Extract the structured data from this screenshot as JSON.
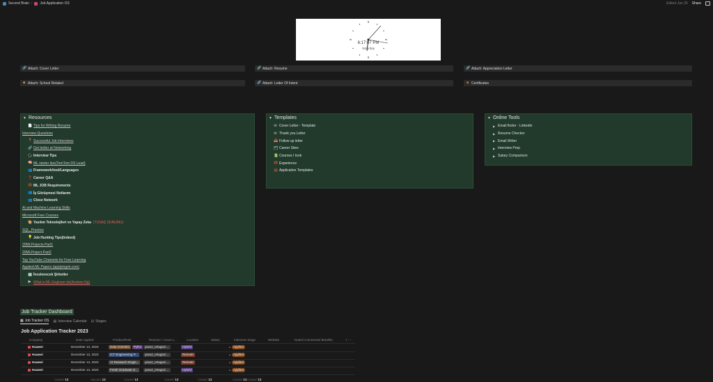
{
  "breadcrumb": {
    "workspace": "Second Brain",
    "page": "Job Application OS"
  },
  "topbar": {
    "edited": "Edited Jan 26",
    "share": "Share"
  },
  "clock": {
    "time": "6:17:07 PM",
    "day": "Saturday"
  },
  "attachments": [
    {
      "label": "Attach: Cover Letter",
      "icon": "link-icon"
    },
    {
      "label": "Attach: Resume",
      "icon": "link-icon"
    },
    {
      "label": "Attach: Appreciation Letter",
      "icon": "link-icon"
    },
    {
      "label": "Attach: School Related",
      "icon": "folder-icon"
    },
    {
      "label": "Attach: Letter Of Intent",
      "icon": "link-icon"
    },
    {
      "label": "Certificates",
      "icon": "certificate-icon"
    }
  ],
  "resources": {
    "title": "Resources",
    "items": [
      {
        "label": "Tips for Writing Resume",
        "style": "link",
        "icon": "📄"
      },
      {
        "label": "Interview Questions",
        "style": "link",
        "icon": ""
      },
      {
        "label": "Successful Job Interviews",
        "style": "link",
        "icon": "📍"
      },
      {
        "label": "Get better at Networking",
        "style": "link",
        "icon": "🔗"
      },
      {
        "label": "Interview Tips",
        "style": "bold",
        "icon": "🗣"
      },
      {
        "label": "ML starter tips(TomTom DS Lead)",
        "style": "link",
        "icon": "🧠"
      },
      {
        "label": "Framework/tool/Languages",
        "style": "bold",
        "icon": "👥"
      },
      {
        "label": "Career Q&A",
        "style": "bold",
        "icon": "❓"
      },
      {
        "label": "ML JOB Requirements",
        "style": "bold",
        "icon": "💼"
      },
      {
        "label": "İş Görüşmesi Notlarım",
        "style": "bold",
        "icon": "👥"
      },
      {
        "label": "Close Network",
        "style": "bold",
        "icon": "👥"
      },
      {
        "label": "AI and Machine Learning Skills",
        "style": "link",
        "icon": ""
      },
      {
        "label": "Microsoft Free Courses",
        "style": "link",
        "icon": ""
      },
      {
        "label": "Yazılım Teknolojileri ve Yapay Zeka",
        "extra": "(TUSAŞ SUNUMU)",
        "style": "bold",
        "icon": "🎨"
      },
      {
        "label": "SQL_Practice",
        "style": "link",
        "icon": ""
      },
      {
        "label": "Job Hunting Tips(Indeed)",
        "style": "bold",
        "icon": "💡"
      },
      {
        "label": "20MLProjects-Part1",
        "style": "link",
        "icon": ""
      },
      {
        "label": "20MLProject-Part2",
        "style": "link",
        "icon": ""
      },
      {
        "label": "Top YouTube Channels for Free Learning",
        "style": "link",
        "icon": ""
      },
      {
        "label": "Applied-ML Papers (applyingml.com)",
        "style": "link",
        "icon": ""
      },
      {
        "label": "İncelenecek Şirketler",
        "style": "bold",
        "icon": "🏢"
      },
      {
        "label": "What is ML Engineer do(Andrew Ng)",
        "style": "red",
        "icon": "▶"
      }
    ]
  },
  "templates": {
    "title": "Templates",
    "items": [
      {
        "label": "Cover Letter - Template",
        "icon": "✉"
      },
      {
        "label": "Thank you Letter",
        "icon": "✉"
      },
      {
        "label": "Follow up letter",
        "icon": "📤"
      },
      {
        "label": "Career Sites",
        "icon": "🗂"
      },
      {
        "label": "Courses I took",
        "icon": "📗"
      },
      {
        "label": "Experience",
        "icon": "💼"
      },
      {
        "label": "Application Templates",
        "icon": "💼"
      }
    ]
  },
  "online_tools": {
    "title": "Online Tools",
    "items": [
      {
        "label": "Email finder - Linkedin"
      },
      {
        "label": "Resume Checker"
      },
      {
        "label": "Email Writer"
      },
      {
        "label": "Interview Prep"
      },
      {
        "label": "Salary Comparison"
      }
    ]
  },
  "dashboard": {
    "title": "Job Tracker Dashboard",
    "tabs": [
      {
        "label": "Job Tracker OS",
        "active": true
      },
      {
        "label": "Interview Calendar",
        "active": false
      },
      {
        "label": "Stages",
        "active": false
      }
    ],
    "tracker_title": "Job Application Tracker 2023",
    "columns": [
      "Company",
      "Date Applied",
      "Position/Role",
      "Resume / Cover L...",
      "Location",
      "Salary",
      "Interview Stage",
      "Website",
      "Notes/ Comments/ Benefits"
    ],
    "rows": [
      {
        "company": "Huawei",
        "date": "December 13, 2023",
        "position": "Data Scientist",
        "position2": "Pytho",
        "resume": "yavuz_ertugrul....",
        "location": "Hybrid",
        "stage": "Applied"
      },
      {
        "company": "Huawei",
        "date": "December 13, 2023",
        "position": "ICT Engineering P...",
        "position2": "",
        "resume": "yavuz_ertugrul....",
        "location": "Remote",
        "stage": "Applied"
      },
      {
        "company": "Huawei",
        "date": "December 13, 2023",
        "position": "AI Research Engin...",
        "position2": "",
        "resume": "yavuz_ertugrul....",
        "location": "Remote",
        "stage": "Applied"
      },
      {
        "company": "Huawei",
        "date": "December 13, 2023",
        "position": "Fresh Graduate G...",
        "position2": "",
        "resume": "yavuz_ertugrul....",
        "location": "Hybrid",
        "stage": "Applied"
      }
    ],
    "footer": [
      {
        "label": "COUNT",
        "value": "13"
      },
      {
        "label": "VALUES",
        "value": "13"
      },
      {
        "label": "COUNT",
        "value": "13"
      },
      {
        "label": "COUNT",
        "value": "13"
      },
      {
        "label": "COUNT",
        "value": "13"
      },
      {
        "label": "COUNT",
        "value": "13"
      },
      {
        "label": "COUNT",
        "value": "13"
      }
    ]
  },
  "colors": {
    "background": "#191919",
    "panel": "#213a2b",
    "chip_data": "#6b4a2a",
    "chip_ict": "#2e4a7a",
    "chip_hybrid": "#5a3a8a",
    "chip_remote": "#7a3a2a",
    "chip_applied": "#8a4a1a"
  }
}
